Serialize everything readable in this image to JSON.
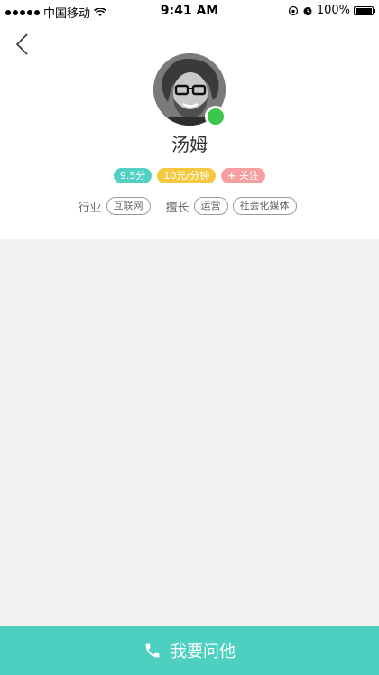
{
  "status_bar": {
    "carrier": "中国移动",
    "time": "9:41 AM",
    "battery": "100%"
  },
  "profile": {
    "name": "汤姆",
    "online": true
  },
  "badges": {
    "score": "9.5分",
    "price": "10元/分钟",
    "follow": "关注"
  },
  "industry": {
    "label": "行业",
    "tags": [
      "互联网"
    ]
  },
  "skills": {
    "label": "擅长",
    "tags": [
      "运营",
      "社会化媒体"
    ]
  },
  "action": {
    "label": "我要问他"
  }
}
